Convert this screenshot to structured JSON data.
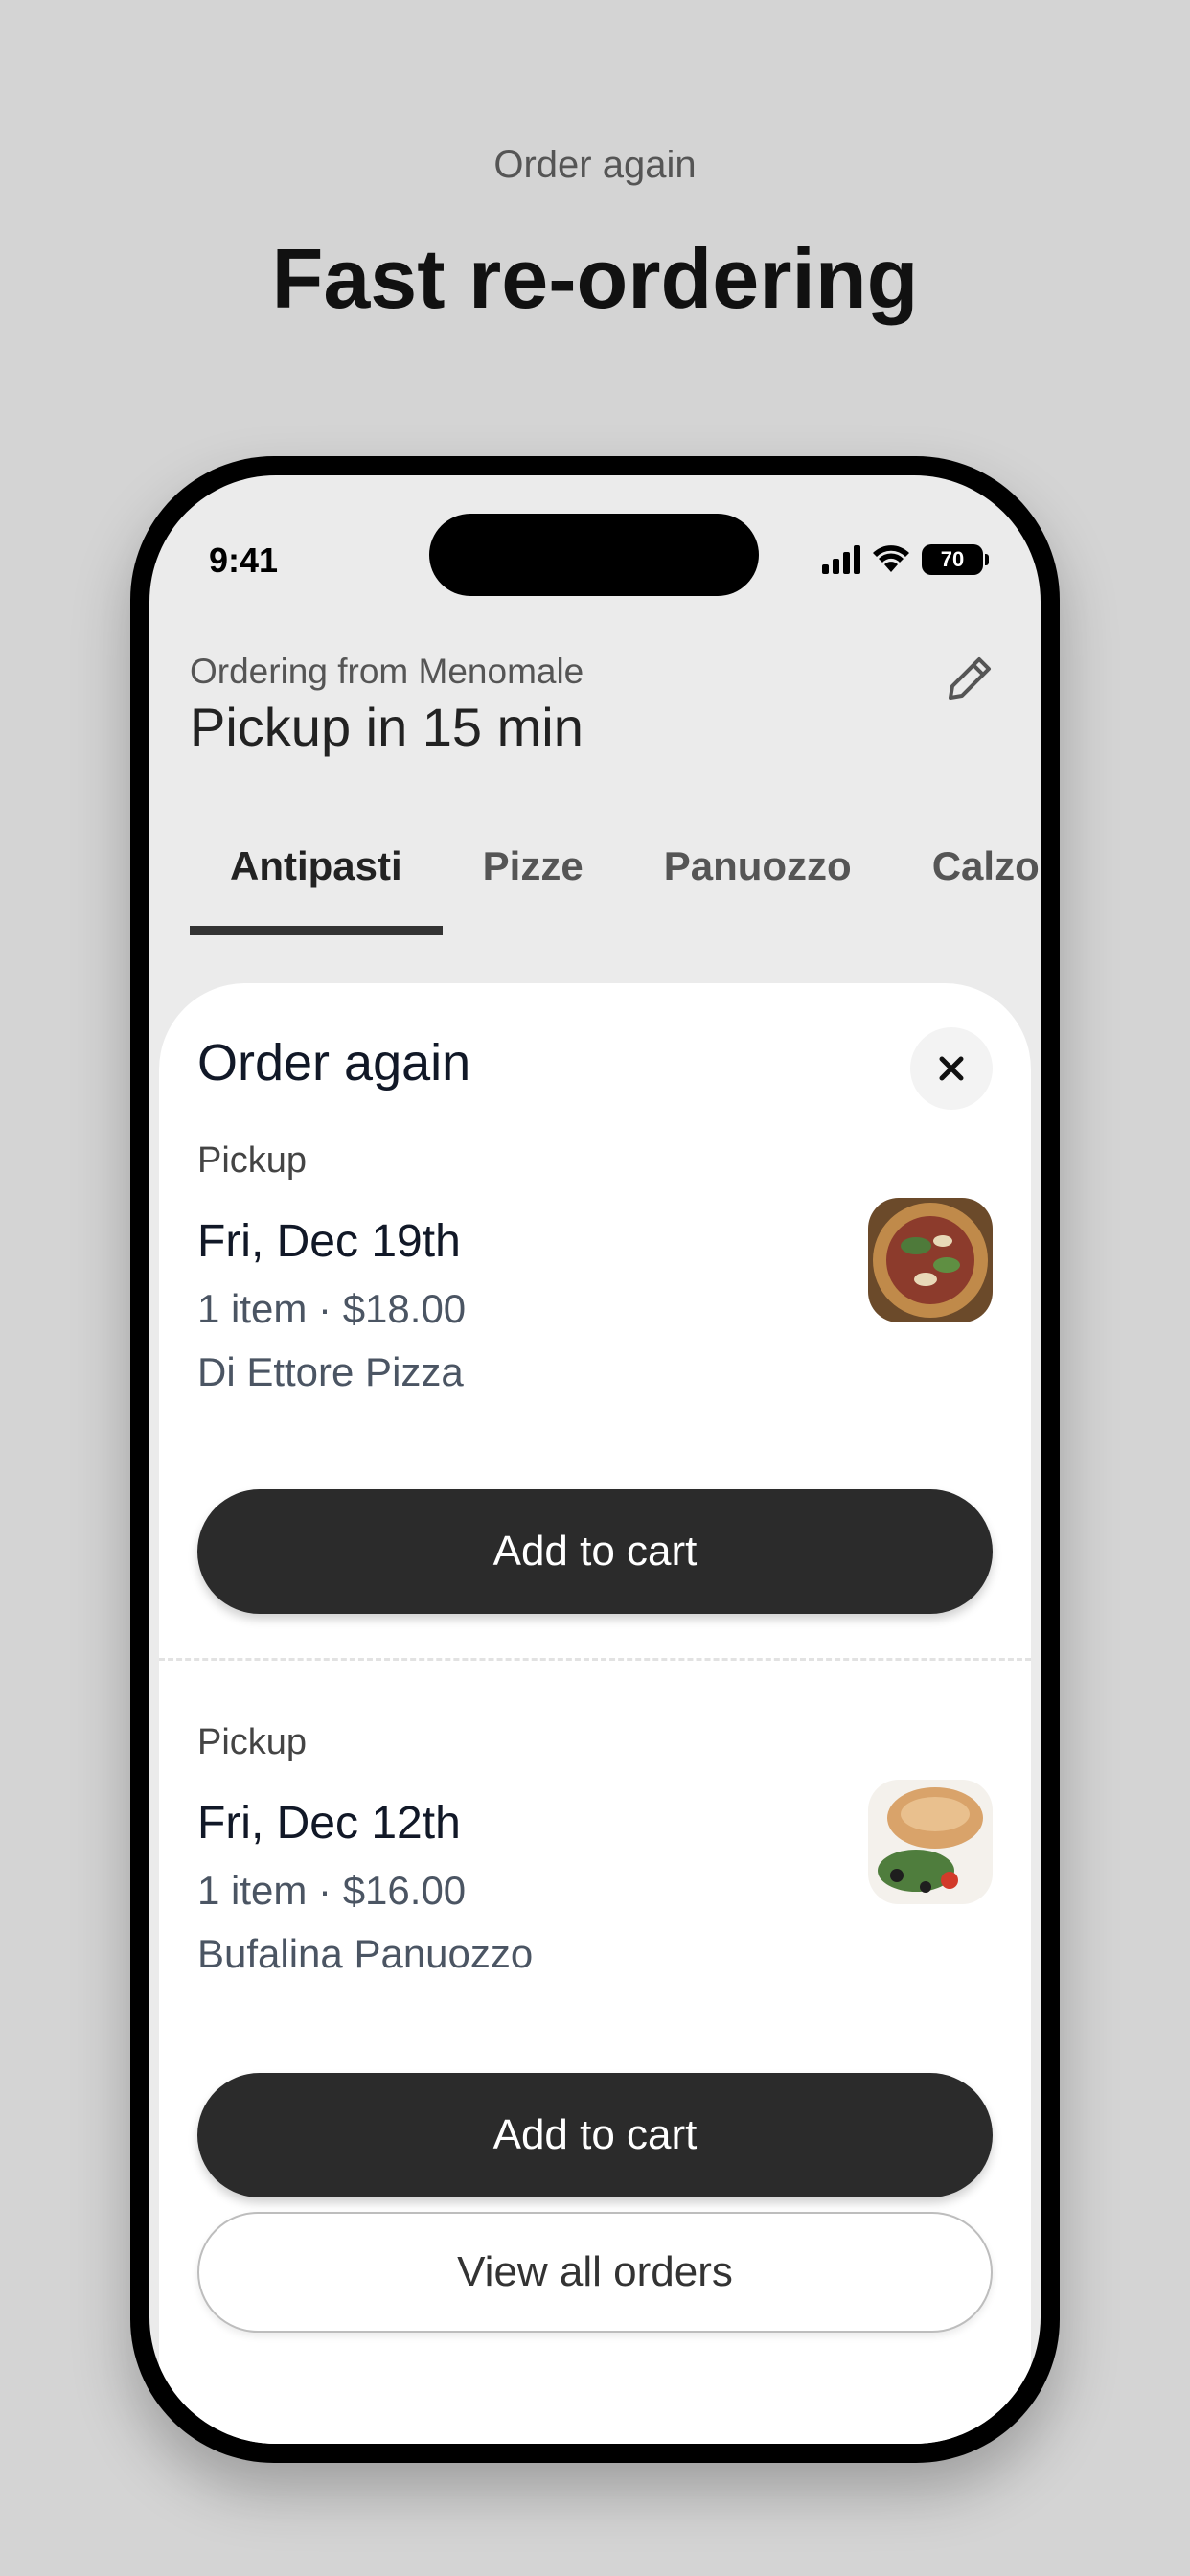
{
  "promo": {
    "eyebrow": "Order again",
    "headline": "Fast re-ordering"
  },
  "status_bar": {
    "time": "9:41",
    "battery": "70"
  },
  "header": {
    "ordering_from": "Ordering from Menomale",
    "pickup_title": "Pickup in 15 min",
    "edit_icon": "pencil-icon"
  },
  "tabs": [
    {
      "label": "Antipasti",
      "active": true
    },
    {
      "label": "Pizze",
      "active": false
    },
    {
      "label": "Panuozzo",
      "active": false
    },
    {
      "label": "Calzoni",
      "active": false
    }
  ],
  "sheet": {
    "title": "Order again",
    "close_icon": "close-icon",
    "orders": [
      {
        "type": "Pickup",
        "date": "Fri, Dec 19th",
        "meta": "1 item · $18.00",
        "item": "Di Ettore Pizza",
        "button": "Add to cart"
      },
      {
        "type": "Pickup",
        "date": "Fri, Dec 12th",
        "meta": "1 item · $16.00",
        "item": "Bufalina Panuozzo",
        "button": "Add to cart"
      }
    ],
    "view_all": "View all orders"
  },
  "colors": {
    "background": "#d4d4d4",
    "primary_button": "#2b2b2b",
    "sheet": "#ffffff"
  }
}
